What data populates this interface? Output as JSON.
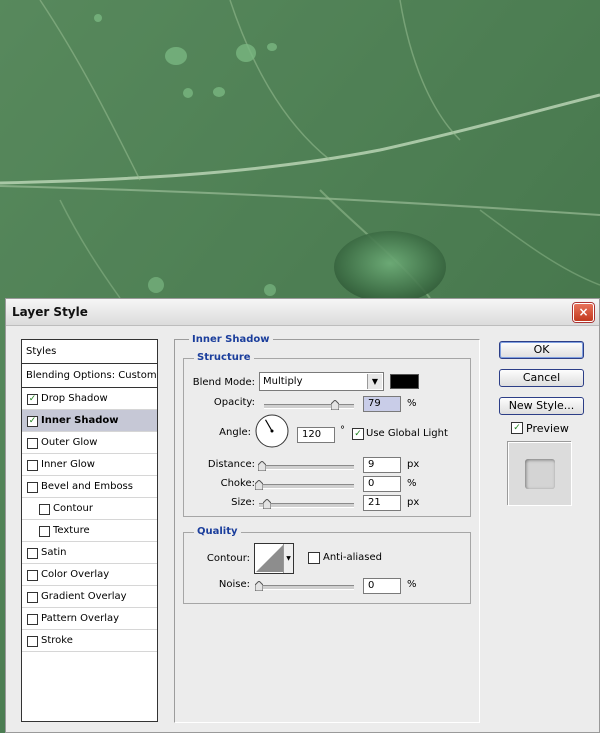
{
  "dialog": {
    "title": "Layer Style",
    "close_glyph": "×"
  },
  "styles_list": {
    "header": "Styles",
    "blending": "Blending Options: Custom",
    "items": [
      {
        "label": "Drop Shadow",
        "checked": true,
        "selected": false,
        "sub": false
      },
      {
        "label": "Inner Shadow",
        "checked": true,
        "selected": true,
        "sub": false
      },
      {
        "label": "Outer Glow",
        "checked": false,
        "selected": false,
        "sub": false
      },
      {
        "label": "Inner Glow",
        "checked": false,
        "selected": false,
        "sub": false
      },
      {
        "label": "Bevel and Emboss",
        "checked": false,
        "selected": false,
        "sub": false
      },
      {
        "label": "Contour",
        "checked": false,
        "selected": false,
        "sub": true
      },
      {
        "label": "Texture",
        "checked": false,
        "selected": false,
        "sub": true
      },
      {
        "label": "Satin",
        "checked": false,
        "selected": false,
        "sub": false
      },
      {
        "label": "Color Overlay",
        "checked": false,
        "selected": false,
        "sub": false
      },
      {
        "label": "Gradient Overlay",
        "checked": false,
        "selected": false,
        "sub": false
      },
      {
        "label": "Pattern Overlay",
        "checked": false,
        "selected": false,
        "sub": false
      },
      {
        "label": "Stroke",
        "checked": false,
        "selected": false,
        "sub": false
      }
    ]
  },
  "inner_shadow": {
    "section_title": "Inner Shadow",
    "structure_title": "Structure",
    "blend_mode_label": "Blend Mode:",
    "blend_mode_value": "Multiply",
    "blend_color": "#000000",
    "opacity_label": "Opacity:",
    "opacity_value": "79",
    "opacity_unit": "%",
    "angle_label": "Angle:",
    "angle_value": "120",
    "angle_unit": "°",
    "use_global_light_label": "Use Global Light",
    "use_global_light_checked": true,
    "distance_label": "Distance:",
    "distance_value": "9",
    "distance_unit": "px",
    "choke_label": "Choke:",
    "choke_value": "0",
    "choke_unit": "%",
    "size_label": "Size:",
    "size_value": "21",
    "size_unit": "px"
  },
  "quality": {
    "title": "Quality",
    "contour_label": "Contour:",
    "anti_aliased_label": "Anti-aliased",
    "anti_aliased_checked": false,
    "noise_label": "Noise:",
    "noise_value": "0",
    "noise_unit": "%"
  },
  "buttons": {
    "ok": "OK",
    "cancel": "Cancel",
    "new_style": "New Style...",
    "preview_label": "Preview",
    "preview_checked": true
  },
  "check_glyph": "✓",
  "dropdown_glyph": "▼"
}
